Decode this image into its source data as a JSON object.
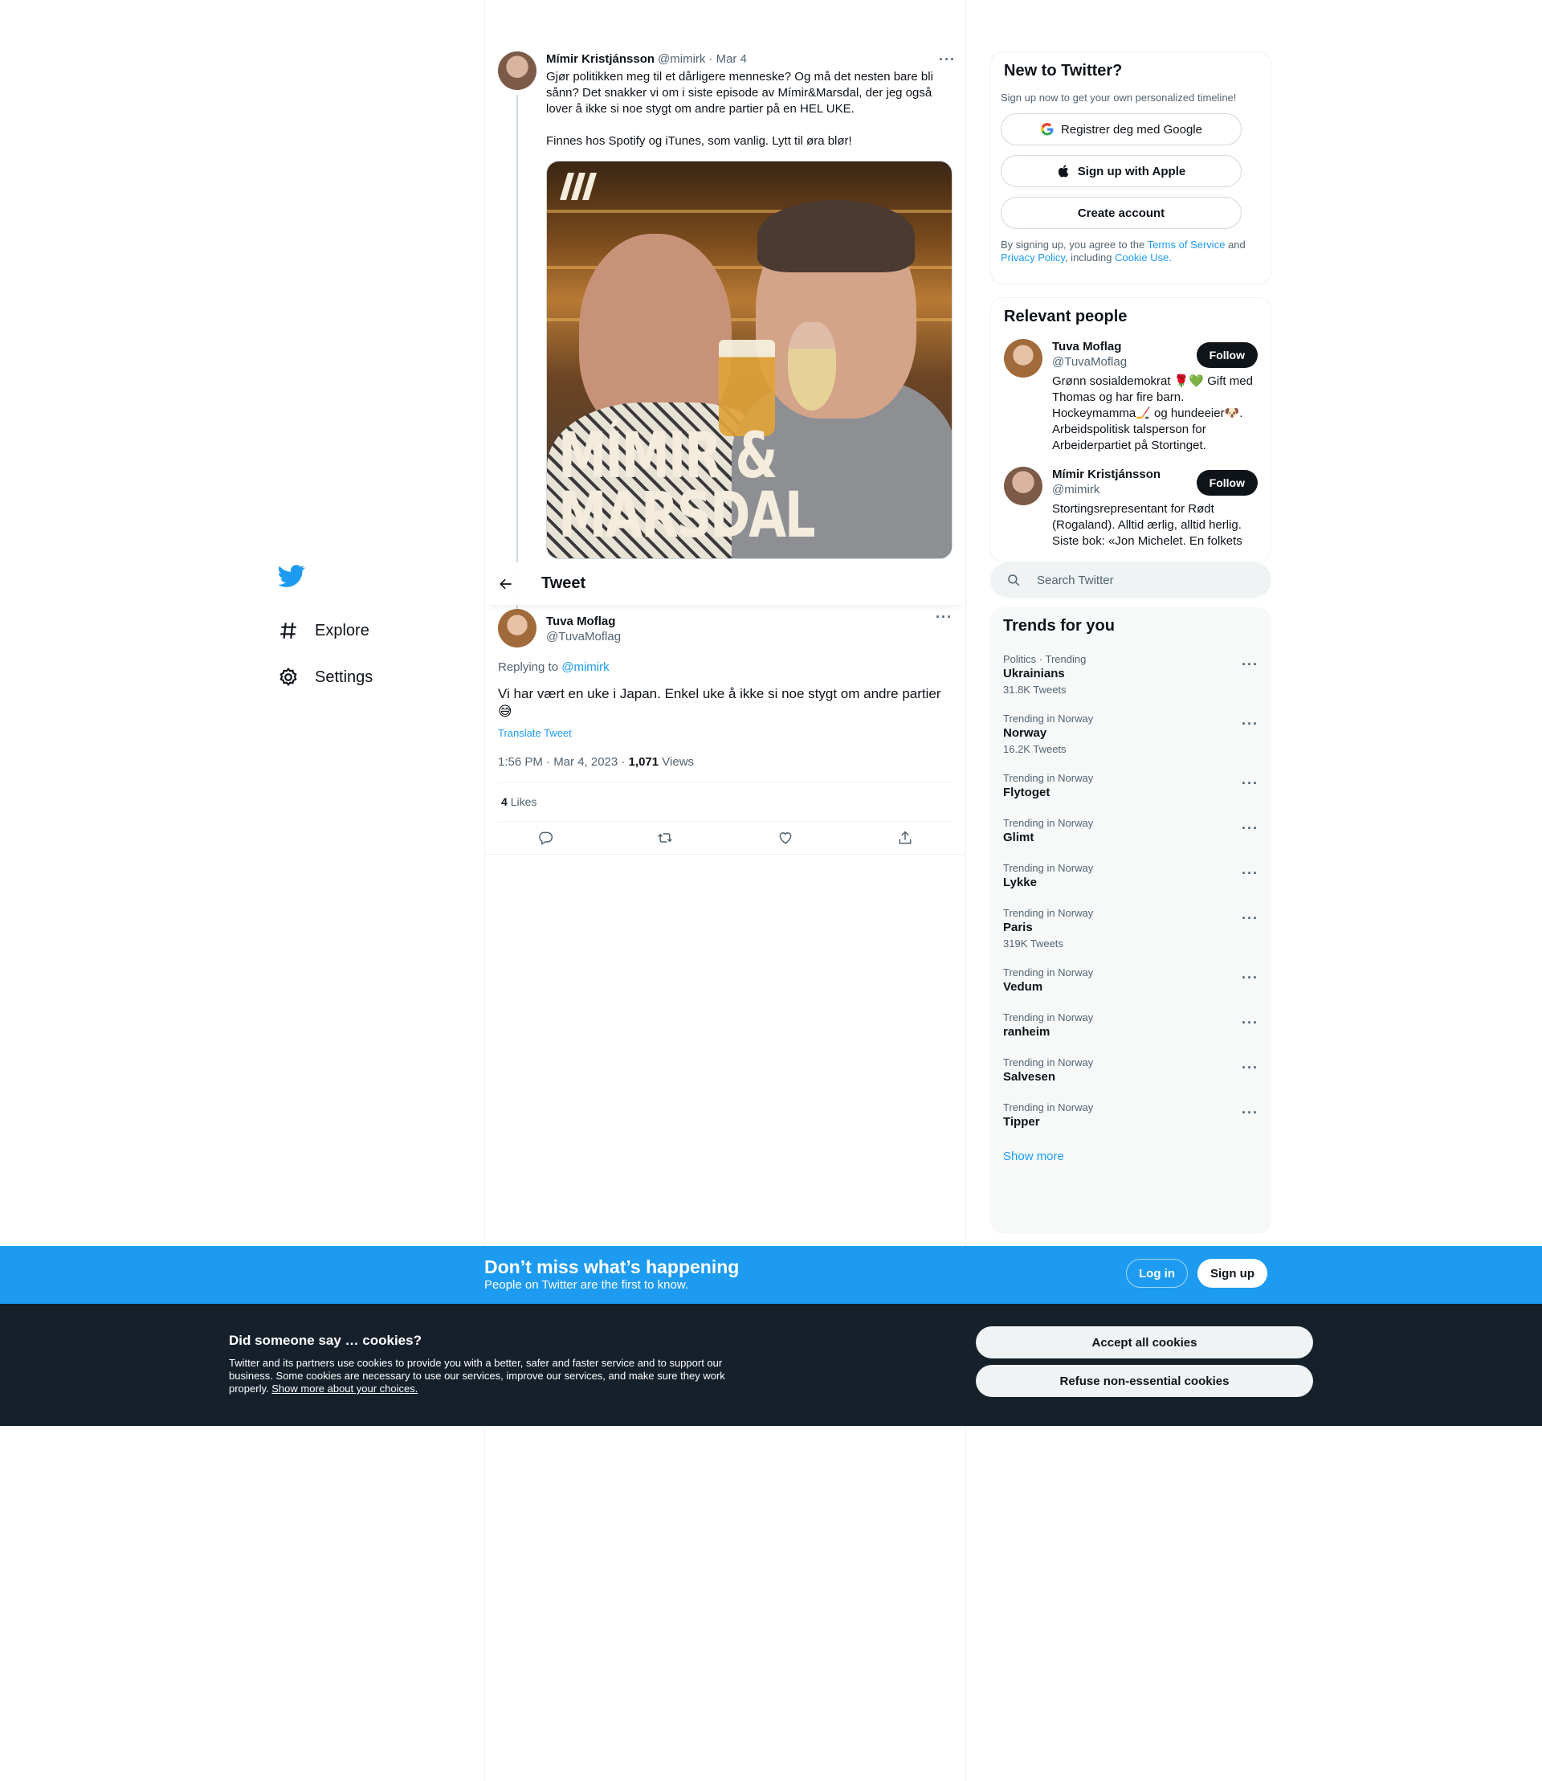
{
  "nav": {
    "items": [
      {
        "label": "Explore",
        "icon": "hashtag-icon"
      },
      {
        "label": "Settings",
        "icon": "gear-icon"
      }
    ]
  },
  "parent_tweet": {
    "author": "Mímir Kristjánsson",
    "handle": "@mimirk",
    "date": "· Mar 4",
    "paragraph1": "Gjør politikken meg til et dårligere menneske? Og må det nesten bare bli sånn? Det snakker vi om i siste episode av Mímir&Marsdal, der jeg også lover å ikke si noe stygt om andre partier på en HEL UKE.",
    "paragraph2": "Finnes hos Spotify og iTunes, som vanlig. Lytt til øra blør!",
    "media_title_line1": "MÍMIR &",
    "media_title_line2": "MARSDAL"
  },
  "header": {
    "title": "Tweet"
  },
  "main_tweet": {
    "author": "Tuva Moflag",
    "handle": "@TuvaMoflag",
    "replying_prefix": "Replying to",
    "replying_to": "@mimirk",
    "text": "Vi har vært en uke i Japan. Enkel uke å ikke si noe stygt om andre partier 😅",
    "translate": "Translate Tweet",
    "timestamp": "1:56 PM · Mar 4, 2023 ·",
    "views_count": "1,071",
    "views_label": "Views",
    "likes_count": "4",
    "likes_label": "Likes"
  },
  "signup_card": {
    "title": "New to Twitter?",
    "subtitle": "Sign up now to get your own personalized timeline!",
    "google": "Registrer deg med Google",
    "apple": "Sign up with Apple",
    "create": "Create account",
    "legal_1": "By signing up, you agree to the",
    "terms": "Terms of Service",
    "legal_2": "and",
    "privacy": "Privacy Policy",
    "legal_3": ", including",
    "cookie_use": "Cookie Use."
  },
  "relevant_people": {
    "title": "Relevant people",
    "follow_label": "Follow",
    "people": [
      {
        "name": "Tuva Moflag",
        "handle": "@TuvaMoflag",
        "bio": "Grønn sosialdemokrat 🌹💚 Gift med Thomas og har fire barn. Hockeymamma🏒 og hundeeier🐶. Arbeidspolitisk talsperson for Arbeiderpartiet på Stortinget."
      },
      {
        "name": "Mímir Kristjánsson",
        "handle": "@mimirk",
        "bio": "Stortingsrepresentant for Rødt (Rogaland). Alltid ærlig, alltid herlig. Siste bok: «Jon Michelet. En folkets"
      }
    ]
  },
  "search": {
    "placeholder": "Search Twitter"
  },
  "trends": {
    "title": "Trends for you",
    "items": [
      {
        "context": "Politics · Trending",
        "name": "Ukrainians",
        "count": "31.8K Tweets"
      },
      {
        "context": "Trending in Norway",
        "name": "Norway",
        "count": "16.2K Tweets"
      },
      {
        "context": "Trending in Norway",
        "name": "Flytoget",
        "count": ""
      },
      {
        "context": "Trending in Norway",
        "name": "Glimt",
        "count": ""
      },
      {
        "context": "Trending in Norway",
        "name": "Lykke",
        "count": ""
      },
      {
        "context": "Trending in Norway",
        "name": "Paris",
        "count": "319K Tweets"
      },
      {
        "context": "Trending in Norway",
        "name": "Vedum",
        "count": ""
      },
      {
        "context": "Trending in Norway",
        "name": "ranheim",
        "count": ""
      },
      {
        "context": "Trending in Norway",
        "name": "Salvesen",
        "count": ""
      },
      {
        "context": "Trending in Norway",
        "name": "Tipper",
        "count": ""
      }
    ],
    "show_more": "Show more"
  },
  "banner": {
    "title": "Don’t miss what’s happening",
    "subtitle": "People on Twitter are the first to know.",
    "login": "Log in",
    "signup": "Sign up"
  },
  "cookies": {
    "title": "Did someone say … cookies?",
    "body": "Twitter and its partners use cookies to provide you with a better, safer and faster service and to support our business. Some cookies are necessary to use our services, improve our services, and make sure they work properly.",
    "link": "Show more about your choices.",
    "accept": "Accept all cookies",
    "refuse": "Refuse non-essential cookies"
  },
  "colors": {
    "accent": "#1d9bf0",
    "text": "#0f1419",
    "secondary": "#536471",
    "cookie_bg": "#15202b"
  }
}
